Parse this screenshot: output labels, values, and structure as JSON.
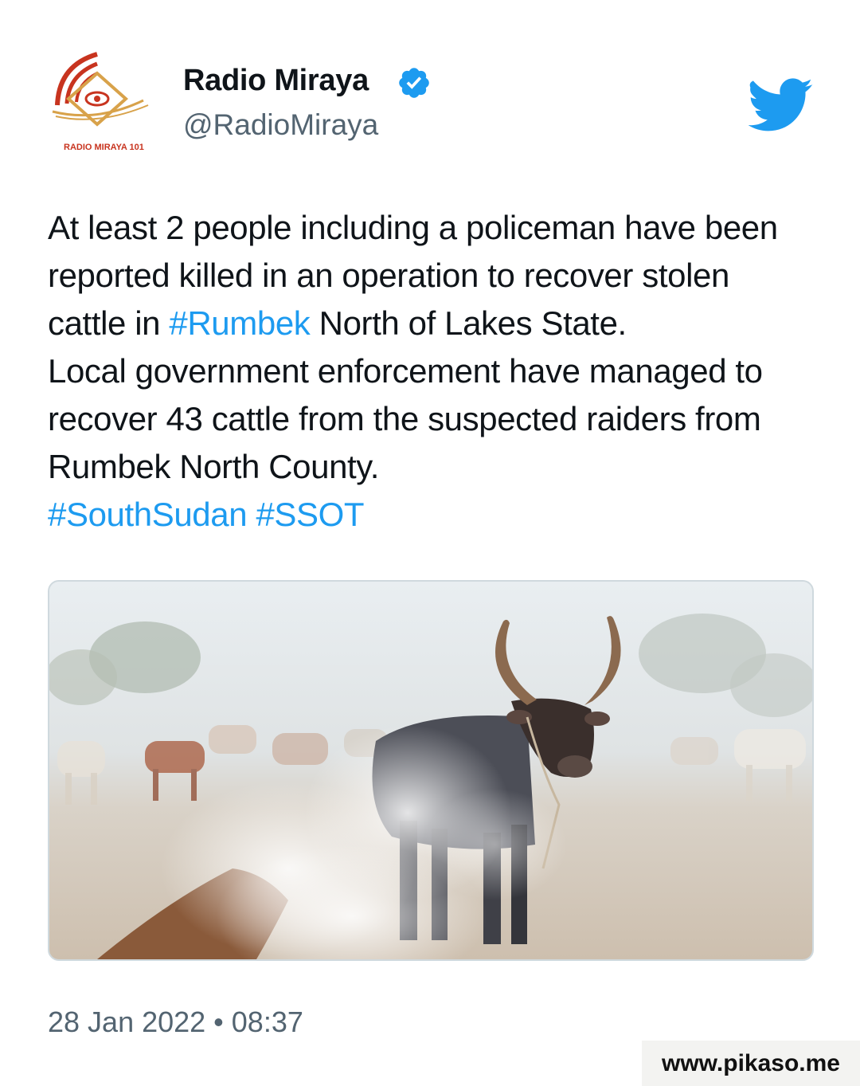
{
  "author": {
    "display_name": "Radio Miraya",
    "handle": "@RadioMiraya",
    "avatar_text": "RADIO MIRAYA 101",
    "avatar_icon": "radio-miraya-logo-icon",
    "verified_icon": "verified-badge-icon"
  },
  "brand": {
    "logo_icon": "twitter-bird-icon",
    "accent_color": "#1d9bf0"
  },
  "tweet": {
    "segments": [
      {
        "text": "At least 2 people including a policeman have been reported killed in an operation to recover stolen cattle in ",
        "type": "text"
      },
      {
        "text": "#Rumbek",
        "type": "hashtag"
      },
      {
        "text": " North of Lakes State.",
        "type": "text"
      },
      {
        "text": "Local government enforcement have managed to recover 43 cattle from the suspected raiders from  Rumbek North County.",
        "type": "text"
      },
      {
        "text": "#SouthSudan",
        "type": "hashtag"
      },
      {
        "text": " ",
        "type": "text"
      },
      {
        "text": "#SSOT",
        "type": "hashtag"
      }
    ]
  },
  "media": {
    "icon": "cattle-camp-photo"
  },
  "timestamp": "28 Jan 2022 • 08:37",
  "watermark": "www.pikaso.me"
}
